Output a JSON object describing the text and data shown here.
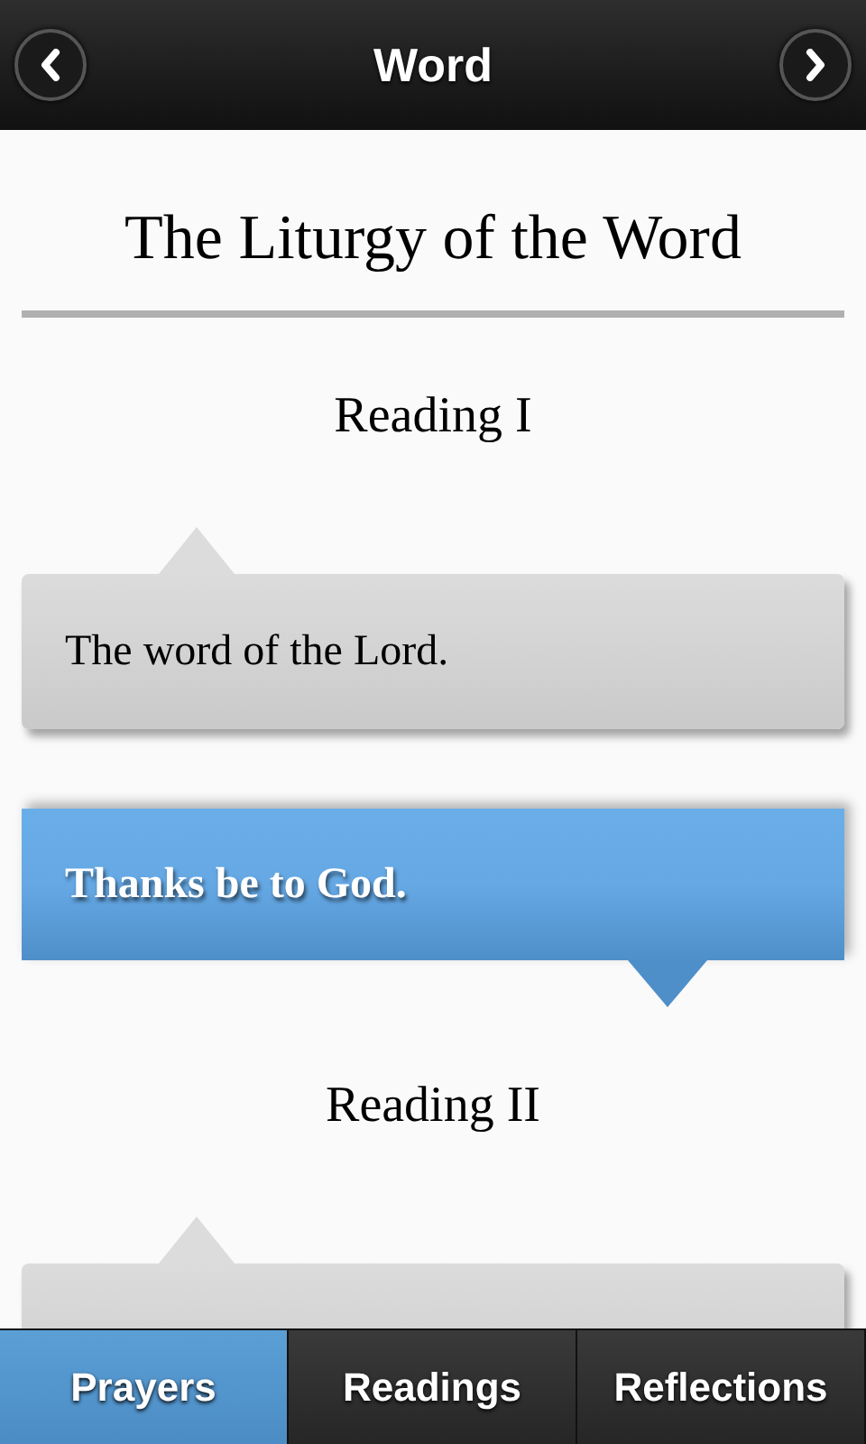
{
  "header": {
    "title": "Word"
  },
  "page_title": "The Liturgy of the Word",
  "sections": [
    {
      "heading": "Reading I",
      "responses": [
        {
          "kind": "minister",
          "text": "The word of the Lord."
        },
        {
          "kind": "people",
          "text": "Thanks be to God."
        }
      ]
    },
    {
      "heading": "Reading II",
      "responses": [
        {
          "kind": "minister"
        }
      ]
    }
  ],
  "tabs": [
    {
      "label": "Prayers",
      "selected": true
    },
    {
      "label": "Readings",
      "selected": false
    },
    {
      "label": "Reflections",
      "selected": false
    }
  ]
}
